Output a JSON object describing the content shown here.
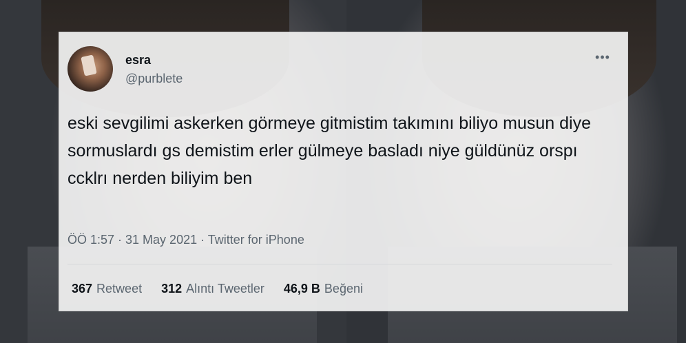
{
  "tweet": {
    "display_name": "esra",
    "handle": "@purblete",
    "more_icon": "•••",
    "text": "eski sevgilimi askerken görmeye gitmistim takımını biliyo musun diye sormuslardı gs demistim erler gülmeye basladı niye güldünüz orspı ccklrı nerden biliyim ben",
    "meta": "ÖÖ 1:57 · 31 May 2021 · Twitter for iPhone",
    "stats": [
      {
        "count": "367",
        "label": "Retweet"
      },
      {
        "count": "312",
        "label": "Alıntı Tweetler"
      },
      {
        "count": "46,9 B",
        "label": "Beğeni"
      }
    ]
  },
  "icons": {
    "avatar": "profile-photo",
    "more": "more-options-icon"
  }
}
